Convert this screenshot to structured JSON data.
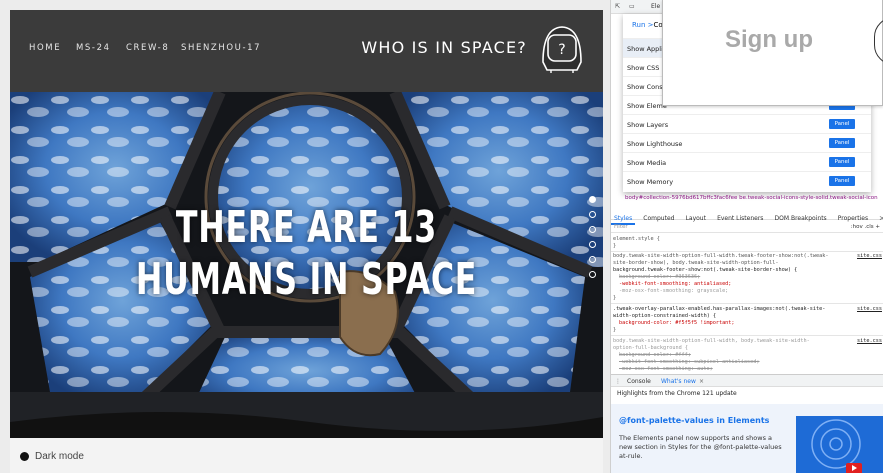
{
  "site": {
    "nav": [
      "HOME",
      "MS-24",
      "CREW-8",
      "SHENZHOU-17"
    ],
    "title": "WHO IS IN SPACE?",
    "helmet_glyph": "?",
    "headline": "THERE ARE 13 HUMANS IN SPACE",
    "slide_count": 6,
    "active_slide": 0,
    "footer": {
      "dark_mode_label": "Dark mode"
    }
  },
  "signup": {
    "label": "Sign up"
  },
  "devtools": {
    "topbar": {
      "tab_fragment": "Ele"
    },
    "command_menu": {
      "run_prefix": "Run >",
      "run_fragment": "Co",
      "items": [
        {
          "label": "Show Appli",
          "button": ""
        },
        {
          "label": "Show CSS (",
          "button": ""
        },
        {
          "label": "Show Cons",
          "button": ""
        },
        {
          "label": "Show Eleme",
          "button": "Panel"
        },
        {
          "label": "Show Layers",
          "button": "Panel"
        },
        {
          "label": "Show Lighthouse",
          "button": "Panel"
        },
        {
          "label": "Show Media",
          "button": "Panel"
        },
        {
          "label": "Show Memory",
          "button": "Panel"
        }
      ]
    },
    "breadcrumb": "body#collection-5976bd617bffc3fac6fee be.tweak-social-icons-style-solid.tweak-social-icon",
    "tabs": [
      "Styles",
      "Computed",
      "Layout",
      "Event Listeners",
      "DOM Breakpoints",
      "Properties",
      ">>"
    ],
    "filter": {
      "placeholder": "Filter",
      "tools": ":hov .cls +"
    },
    "css": {
      "element_style": "element.style {",
      "close": "}",
      "rule1_sel": "body.tweak-site-width-option-full-width.tweak-footer-show:not(.tweak-",
      "rule1_sel2": "site-border-show), body.tweak-site-width-option-full-",
      "rule1_sel3": "background.tweak-footer-show:not(.tweak-site-border-show) {",
      "rule1_p1": "background-color: #363636;",
      "rule1_p2": "-webkit-font-smoothing: antialiased;",
      "rule1_p3": "-moz-osx-font-smoothing: grayscale;",
      "rule1_src": "site.css",
      "rule2_sel": ".tweak-overlay-parallax-enabled.has-parallax-images:not(.tweak-site-",
      "rule2_sel2": "width-option-constrained-width) {",
      "rule2_p1": "background-color: #f5f5f5 !important;",
      "rule2_src": "site.css",
      "rule3_sel": "body.tweak-site-width-option-full-width, body.tweak-site-width-",
      "rule3_sel2": "option-full-background {",
      "rule3_p1": "background-color: #fff;",
      "rule3_p2": "-webkit-font-smoothing: subpixel-antialiased;",
      "rule3_p3": "-moz-osx-font-smoothing: auto;",
      "rule3_src": "site.css"
    },
    "drawer": {
      "console": "Console",
      "whats_new": "What's new",
      "close": "×"
    },
    "whats_new": {
      "subtitle": "Highlights from the Chrome 121 update",
      "card_title": "@font-palette-values in Elements",
      "card_body": "The Elements panel now supports and shows a new section in Styles for the @font-palette-values at-rule."
    }
  },
  "colors": {
    "header_bg": "#3b3b3b",
    "devtools_blue": "#1a73e8"
  }
}
